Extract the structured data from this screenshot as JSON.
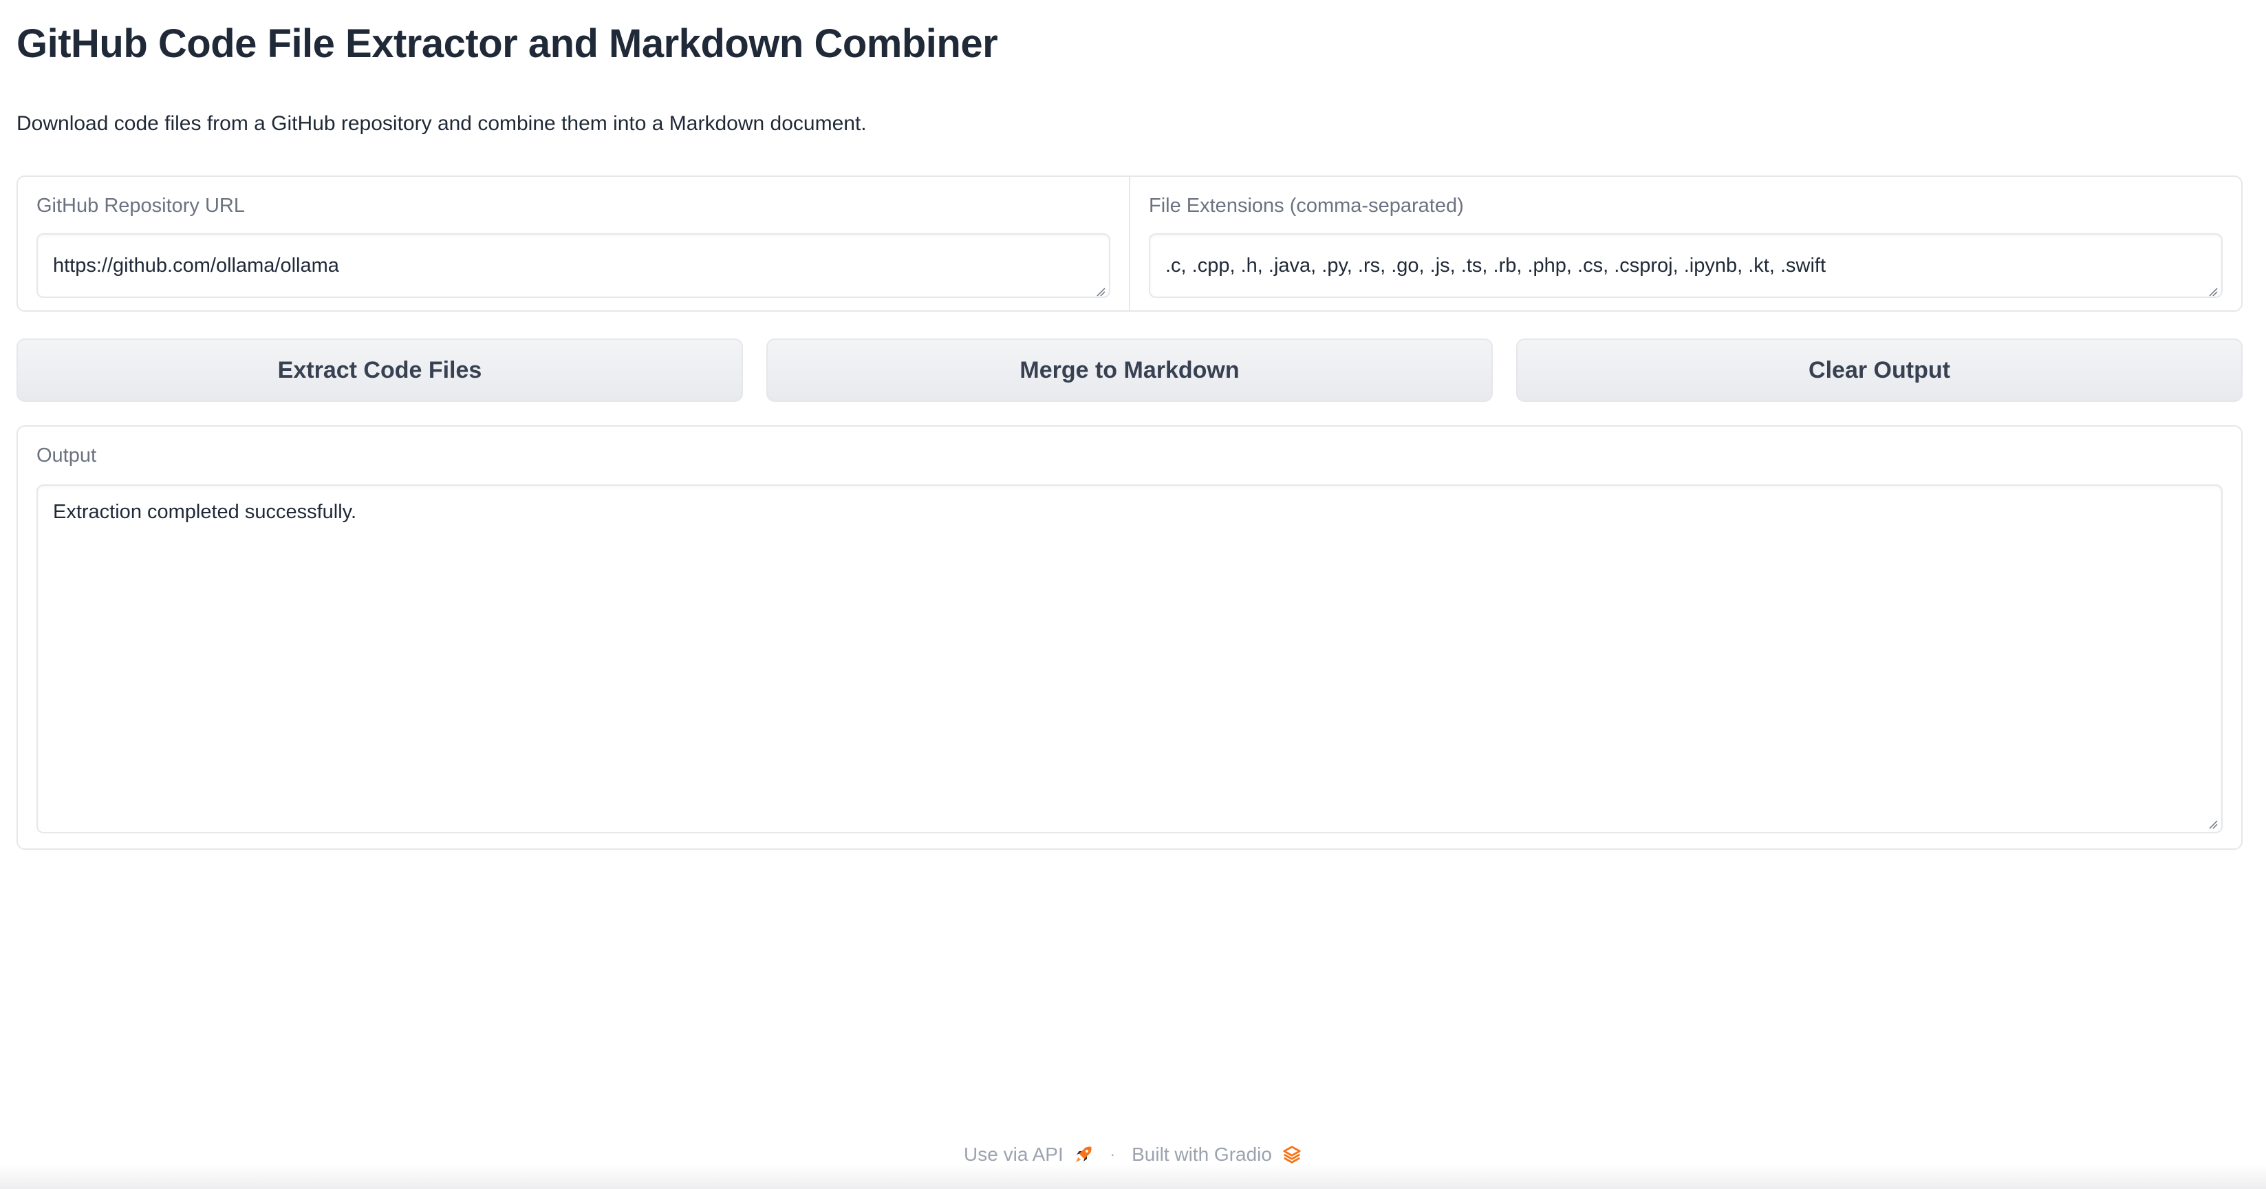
{
  "app": {
    "title": "GitHub Code File Extractor and Markdown Combiner",
    "description": "Download code files from a GitHub repository and combine them into a Markdown document."
  },
  "inputs": {
    "repo_url": {
      "label": "GitHub Repository URL",
      "value": "https://github.com/ollama/ollama"
    },
    "extensions": {
      "label": "File Extensions (comma-separated)",
      "value": ".c, .cpp, .h, .java, .py, .rs, .go, .js, .ts, .rb, .php, .cs, .csproj, .ipynb, .kt, .swift"
    }
  },
  "buttons": {
    "extract": "Extract Code Files",
    "merge": "Merge to Markdown",
    "clear": "Clear Output"
  },
  "output": {
    "label": "Output",
    "value": "Extraction completed successfully."
  },
  "footer": {
    "api_link": "Use via API",
    "separator": "·",
    "built_with": "Built with Gradio",
    "api_icon": "rocket-icon",
    "gradio_icon": "gradio-logo-icon"
  },
  "colors": {
    "accent_orange": "#f97316",
    "border": "#e5e7eb",
    "label": "#6b7280"
  }
}
